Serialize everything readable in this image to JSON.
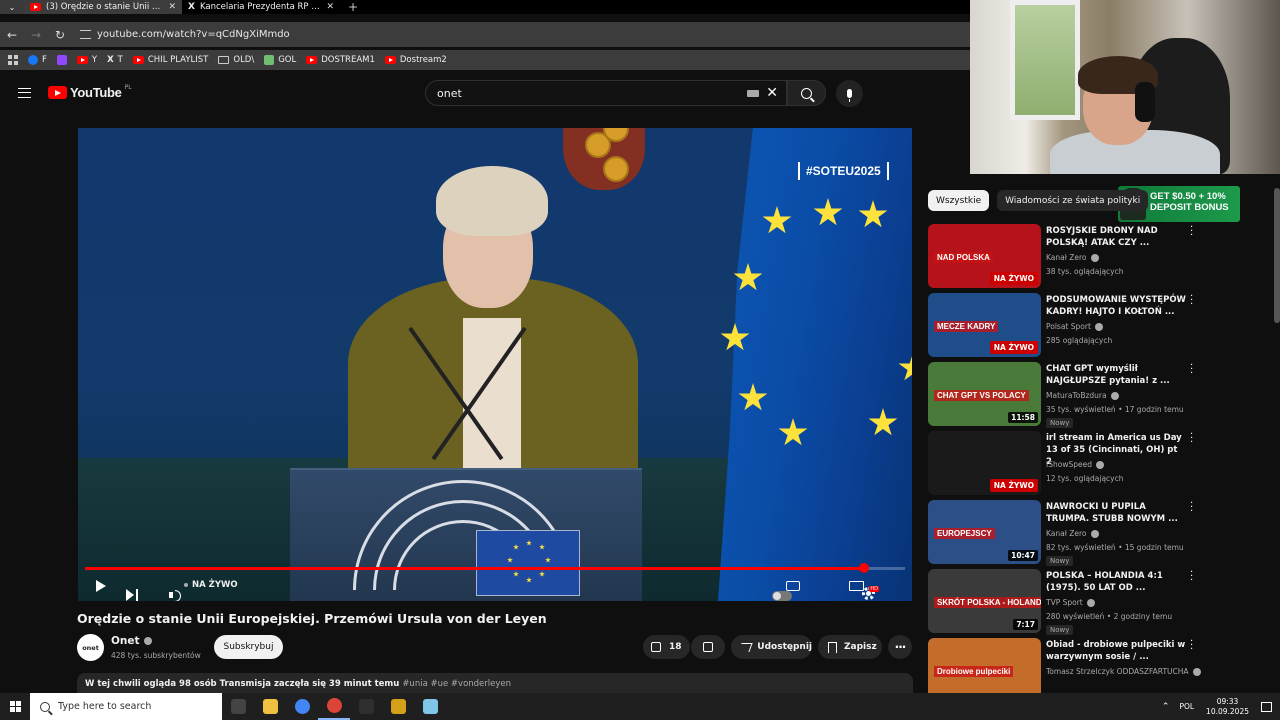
{
  "browser": {
    "tabs": [
      {
        "title": "(3) Orędzie o stanie Unii Europejskiej",
        "active": true,
        "icon": "youtube-icon"
      },
      {
        "title": "Kancelaria Prezydenta RP w serwisie X",
        "active": false,
        "icon": "x-icon"
      }
    ],
    "url": "youtube.com/watch?v=qCdNgXiMmdo",
    "bookmarks": [
      {
        "label": "F",
        "icon": "facebook-icon",
        "color": "#1877f2"
      },
      {
        "label": "",
        "icon": "twitch-icon",
        "color": "#9146ff"
      },
      {
        "label": "Y",
        "icon": "youtube-icon",
        "color": "#ff0000"
      },
      {
        "label": "T",
        "icon": "x-icon",
        "color": "#000000"
      },
      {
        "label": "CHIL PLAYLIST",
        "icon": "youtube-icon",
        "color": "#ff0000"
      },
      {
        "label": "OLD\\",
        "icon": "folder-icon",
        "color": "#cccccc"
      },
      {
        "label": "GOL",
        "icon": "gol-icon",
        "color": "#6fbf73"
      },
      {
        "label": "DOSTREAM1",
        "icon": "youtube-icon",
        "color": "#ff0000"
      },
      {
        "label": "Dostream2",
        "icon": "youtube-icon",
        "color": "#ff0000"
      }
    ]
  },
  "header": {
    "logo_text": "YouTube",
    "region": "PL",
    "search_value": "onet"
  },
  "player": {
    "hashtag": "#SOTEU2025",
    "live_label": "NA ŻYWO",
    "progress": 0.95
  },
  "video": {
    "title": "Orędzie o stanie Unii Europejskiej. Przemówi Ursula von der Leyen",
    "channel_name": "Onet",
    "channel_avatar_text": "onet",
    "subscribers": "428 tys. subskrybentów",
    "subscribe_label": "Subskrybuj",
    "likes": "18",
    "share_label": "Udostępnij",
    "save_label": "Zapisz",
    "description_lead": "W tej chwili ogląda 98 osób  Transmisja zaczęła się 39 minut temu",
    "description_tags": "#unia #ue #vonderleyen"
  },
  "ad": {
    "line1": "GET $0.50 + 10%",
    "line2": "DEPOSIT BONUS"
  },
  "sidebar": {
    "chips": [
      "Wszystkie",
      "Wiadomości ze świata polityki"
    ],
    "items": [
      {
        "title": "ROSYJSKIE DRONY NAD POLSKĄ! ATAK CZY ...",
        "channel": "Kanał Zero",
        "meta": "38 tys. oglądających",
        "badge": "",
        "overlay": "NA ŻYWO",
        "overlay_type": "live",
        "caption": "NAD POLSKA",
        "thumb": "#b5121b"
      },
      {
        "title": "PODSUMOWANIE WYSTĘPÓW KADRY! HAJTO I KOŁTOŃ ...",
        "channel": "Polsat Sport",
        "meta": "285 oglądających",
        "badge": "",
        "overlay": "NA ŻYWO",
        "overlay_type": "live",
        "caption": "MECZE KADRY",
        "thumb": "#1f4d8a"
      },
      {
        "title": "CHAT GPT wymyślił NAJGŁUPSZE pytania! z ...",
        "channel": "MaturaToBzdura",
        "meta": "35 tys. wyświetleń • 17 godzin temu",
        "badge": "Nowy",
        "overlay": "11:58",
        "overlay_type": "duration",
        "caption": "CHAT GPT VS POLACY",
        "thumb": "#4a7a3a"
      },
      {
        "title": "irl stream in America us Day 13 of 35 (Cincinnati, OH) pt 2",
        "channel": "IShowSpeed",
        "meta": "12 tys. oglądających",
        "badge": "",
        "overlay": "NA ŻYWO",
        "overlay_type": "live",
        "caption": "",
        "thumb": "#1a1a1a"
      },
      {
        "title": "NAWROCKI U PUPILA TRUMPA. STUBB NOWYM ...",
        "channel": "Kanał Zero",
        "meta": "82 tys. wyświetleń • 15 godzin temu",
        "badge": "Nowy",
        "overlay": "10:47",
        "overlay_type": "duration",
        "caption": "EUROPEJSCY",
        "thumb": "#2b4f86"
      },
      {
        "title": "POLSKA – HOLANDIA 4:1 (1975). 50 LAT OD ...",
        "channel": "TVP Sport",
        "meta": "280 wyświetleń • 2 godziny temu",
        "badge": "Nowy",
        "overlay": "7:17",
        "overlay_type": "duration",
        "caption": "SKRÓT POLSKA - HOLANDIA 4:1",
        "thumb": "#3a3a3a"
      },
      {
        "title": "Obiad - drobiowe pulpeciki w warzywnym sosie / ...",
        "channel": "Tomasz Strzelczyk ODDASZFARTUCHA",
        "meta": "",
        "badge": "",
        "overlay": "",
        "overlay_type": "none",
        "caption": "Drobiowe pulpeciki",
        "thumb": "#c46d2a"
      }
    ]
  },
  "taskbar": {
    "search_placeholder": "Type here to search",
    "language": "POL",
    "time": "09:33",
    "date": "10.09.2025",
    "apps": [
      {
        "name": "task-view-icon",
        "color": "#444444"
      },
      {
        "name": "file-explorer-icon",
        "color": "#f0c040"
      },
      {
        "name": "chrome-icon",
        "color": "#4285f4"
      },
      {
        "name": "chrome-profile-icon",
        "color": "#db4437"
      },
      {
        "name": "obs-icon",
        "color": "#302e31"
      },
      {
        "name": "app-icon",
        "color": "#d4a017"
      },
      {
        "name": "notepad-icon",
        "color": "#7fc6e8"
      }
    ]
  }
}
